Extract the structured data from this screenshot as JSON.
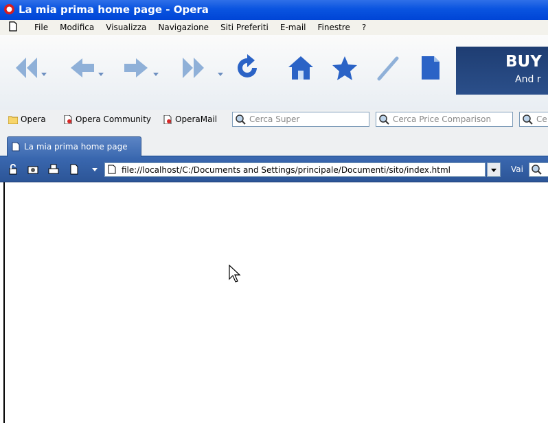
{
  "window": {
    "title": "La mia prima home page - Opera"
  },
  "menu": {
    "items": [
      "File",
      "Modifica",
      "Visualizza",
      "Navigazione",
      "Siti Preferiti",
      "E-mail",
      "Finestre",
      "?"
    ]
  },
  "toolbar": {
    "buttons": [
      "rewind-icon",
      "back-icon",
      "forward-icon",
      "fast-forward-icon",
      "reload-icon",
      "home-icon",
      "bookmark-star-icon",
      "pen-icon",
      "note-icon"
    ],
    "banner": {
      "line1": "BUY",
      "line2": "And r"
    }
  },
  "bookmarks": {
    "items": [
      "Opera",
      "Opera Community",
      "OperaMail"
    ],
    "searches": [
      "Cerca Super",
      "Cerca Price Comparison",
      "Ce"
    ]
  },
  "tabs": [
    {
      "label": "La mia prima home page"
    }
  ],
  "address": {
    "url": "file://localhost/C:/Documents and Settings/principale/Documenti/sito/index.html",
    "go_label": "Vai"
  },
  "colors": {
    "titlebar": "#0a54e0",
    "tab_active": "#4a76bb",
    "address_bar": "#3360a8",
    "banner": "#23457d"
  }
}
